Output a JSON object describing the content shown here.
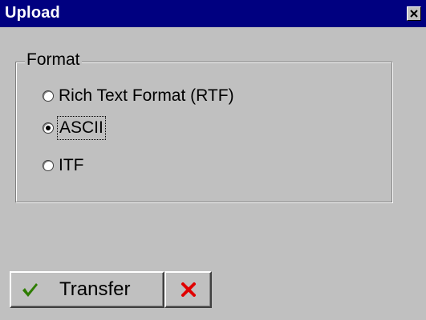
{
  "window": {
    "title": "Upload"
  },
  "format_group": {
    "legend": "Format",
    "options": [
      {
        "label": "Rich Text Format (RTF)",
        "selected": false
      },
      {
        "label": "ASCII",
        "selected": true
      },
      {
        "label": "ITF",
        "selected": false
      }
    ]
  },
  "buttons": {
    "transfer_label": "Transfer",
    "transfer_icon": "checkmark-icon",
    "cancel_icon": "x-icon"
  },
  "colors": {
    "titlebar": "#000080",
    "check_green": "#2e7d00",
    "cancel_red": "#e00000"
  }
}
